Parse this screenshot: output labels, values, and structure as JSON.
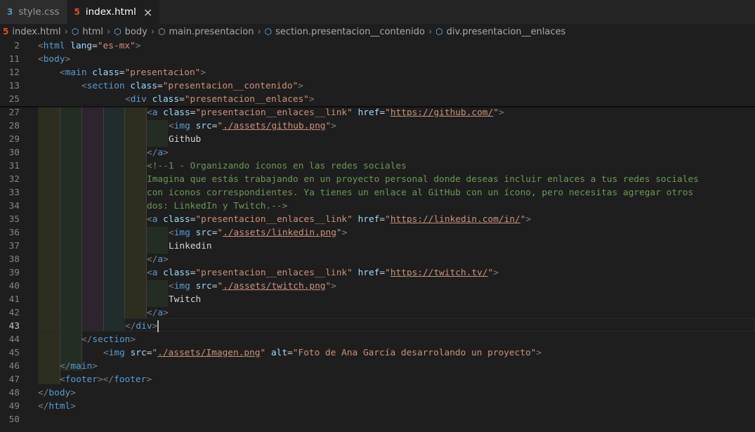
{
  "tabs": [
    {
      "icon": "css3-file-icon",
      "glyph": "3",
      "label": "style.css",
      "active": false
    },
    {
      "icon": "html5-file-icon",
      "glyph": "5",
      "label": "index.html",
      "active": true,
      "close": "×"
    }
  ],
  "breadcrumb": [
    {
      "icon": "html5-file-icon",
      "glyph": "5",
      "label": "index.html"
    },
    {
      "icon": "element-cube-icon",
      "glyph": "⬡",
      "label": "html"
    },
    {
      "icon": "element-cube-icon",
      "glyph": "⬡",
      "label": "body"
    },
    {
      "icon": "element-cube-icon",
      "glyph": "⬡",
      "label": "main.presentacion"
    },
    {
      "icon": "element-cube-icon",
      "glyph": "⬡",
      "label": "section.presentacion__contenido"
    },
    {
      "icon": "element-cube-icon",
      "glyph": "⬡",
      "label": "div.presentacion__enlaces"
    }
  ],
  "breadcrumb_separator": "›",
  "active_line": "43",
  "lines": [
    {
      "n": "2",
      "indent": 0,
      "tokens": [
        [
          "br",
          "<"
        ],
        [
          "tag",
          "html"
        ],
        [
          "txt",
          " "
        ],
        [
          "attr",
          "lang"
        ],
        [
          "txt",
          "="
        ],
        [
          "str",
          "\"es-mx\""
        ],
        [
          "br",
          ">"
        ]
      ]
    },
    {
      "n": "11",
      "indent": 0,
      "tokens": [
        [
          "br",
          "<"
        ],
        [
          "tag",
          "body"
        ],
        [
          "br",
          ">"
        ]
      ]
    },
    {
      "n": "12",
      "indent": 1,
      "tokens": [
        [
          "br",
          "<"
        ],
        [
          "tag",
          "main"
        ],
        [
          "txt",
          " "
        ],
        [
          "attr",
          "class"
        ],
        [
          "txt",
          "="
        ],
        [
          "str",
          "\"presentacion\""
        ],
        [
          "br",
          ">"
        ]
      ]
    },
    {
      "n": "13",
      "indent": 2,
      "tokens": [
        [
          "br",
          "<"
        ],
        [
          "tag",
          "section"
        ],
        [
          "txt",
          " "
        ],
        [
          "attr",
          "class"
        ],
        [
          "txt",
          "="
        ],
        [
          "str",
          "\"presentacion__contenido\""
        ],
        [
          "br",
          ">"
        ]
      ]
    },
    {
      "n": "25",
      "indent": 4,
      "tokens": [
        [
          "br",
          "<"
        ],
        [
          "tag",
          "div"
        ],
        [
          "txt",
          " "
        ],
        [
          "attr",
          "class"
        ],
        [
          "txt",
          "="
        ],
        [
          "str",
          "\"presentacion__enlaces\""
        ],
        [
          "br",
          ">"
        ]
      ]
    },
    {
      "n": "27",
      "indent": 5,
      "tokens": [
        [
          "br",
          "<"
        ],
        [
          "tag",
          "a"
        ],
        [
          "txt",
          " "
        ],
        [
          "attr",
          "class"
        ],
        [
          "txt",
          "="
        ],
        [
          "str",
          "\"presentacion__enlaces__link\""
        ],
        [
          "txt",
          " "
        ],
        [
          "attr",
          "href"
        ],
        [
          "txt",
          "="
        ],
        [
          "str",
          "\""
        ],
        [
          "url",
          "https://github.com/"
        ],
        [
          "str",
          "\""
        ],
        [
          "br",
          ">"
        ]
      ]
    },
    {
      "n": "28",
      "indent": 6,
      "tokens": [
        [
          "br",
          "<"
        ],
        [
          "tag",
          "img"
        ],
        [
          "txt",
          " "
        ],
        [
          "attr",
          "src"
        ],
        [
          "txt",
          "="
        ],
        [
          "str",
          "\""
        ],
        [
          "url",
          "./assets/github.png"
        ],
        [
          "str",
          "\""
        ],
        [
          "br",
          ">"
        ]
      ]
    },
    {
      "n": "29",
      "indent": 6,
      "tokens": [
        [
          "txt",
          "Github"
        ]
      ]
    },
    {
      "n": "30",
      "indent": 5,
      "tokens": [
        [
          "br",
          "</"
        ],
        [
          "tag",
          "a"
        ],
        [
          "br",
          ">"
        ]
      ]
    },
    {
      "n": "31",
      "indent": 5,
      "tokens": [
        [
          "com",
          "<!--1 - Organizando íconos en las redes sociales"
        ]
      ]
    },
    {
      "n": "32",
      "indent": 5,
      "tokens": [
        [
          "com",
          "Imagina que estás trabajando en un proyecto personal donde deseas incluir enlaces a tus redes sociales"
        ]
      ]
    },
    {
      "n": "33",
      "indent": 5,
      "tokens": [
        [
          "com",
          "con iconos correspondientes. Ya tienes un enlace al GitHub con un ícono, pero necesitas agregar otros"
        ]
      ]
    },
    {
      "n": "34",
      "indent": 5,
      "tokens": [
        [
          "com",
          "dos: LinkedIn y Twitch.-->"
        ]
      ]
    },
    {
      "n": "35",
      "indent": 5,
      "tokens": [
        [
          "br",
          "<"
        ],
        [
          "tag",
          "a"
        ],
        [
          "txt",
          " "
        ],
        [
          "attr",
          "class"
        ],
        [
          "txt",
          "="
        ],
        [
          "str",
          "\"presentacion__enlaces__link\""
        ],
        [
          "txt",
          " "
        ],
        [
          "attr",
          "href"
        ],
        [
          "txt",
          "="
        ],
        [
          "str",
          "\""
        ],
        [
          "url",
          "https://linkedin.com/in/"
        ],
        [
          "str",
          "\""
        ],
        [
          "br",
          ">"
        ]
      ]
    },
    {
      "n": "36",
      "indent": 6,
      "tokens": [
        [
          "br",
          "<"
        ],
        [
          "tag",
          "img"
        ],
        [
          "txt",
          " "
        ],
        [
          "attr",
          "src"
        ],
        [
          "txt",
          "="
        ],
        [
          "str",
          "\""
        ],
        [
          "url",
          "./assets/linkedin.png"
        ],
        [
          "str",
          "\""
        ],
        [
          "br",
          ">"
        ]
      ]
    },
    {
      "n": "37",
      "indent": 6,
      "tokens": [
        [
          "txt",
          "Linkedin"
        ]
      ]
    },
    {
      "n": "38",
      "indent": 5,
      "tokens": [
        [
          "br",
          "</"
        ],
        [
          "tag",
          "a"
        ],
        [
          "br",
          ">"
        ]
      ]
    },
    {
      "n": "39",
      "indent": 5,
      "tokens": [
        [
          "br",
          "<"
        ],
        [
          "tag",
          "a"
        ],
        [
          "txt",
          " "
        ],
        [
          "attr",
          "class"
        ],
        [
          "txt",
          "="
        ],
        [
          "str",
          "\"presentacion__enlaces__link\""
        ],
        [
          "txt",
          " "
        ],
        [
          "attr",
          "href"
        ],
        [
          "txt",
          "="
        ],
        [
          "str",
          "\""
        ],
        [
          "url",
          "https://twitch.tv/"
        ],
        [
          "str",
          "\""
        ],
        [
          "br",
          ">"
        ]
      ]
    },
    {
      "n": "40",
      "indent": 6,
      "tokens": [
        [
          "br",
          "<"
        ],
        [
          "tag",
          "img"
        ],
        [
          "txt",
          " "
        ],
        [
          "attr",
          "src"
        ],
        [
          "txt",
          "="
        ],
        [
          "str",
          "\""
        ],
        [
          "url",
          "./assets/twitch.png"
        ],
        [
          "str",
          "\""
        ],
        [
          "br",
          ">"
        ]
      ]
    },
    {
      "n": "41",
      "indent": 6,
      "tokens": [
        [
          "txt",
          "Twitch"
        ]
      ]
    },
    {
      "n": "42",
      "indent": 5,
      "tokens": [
        [
          "br",
          "</"
        ],
        [
          "tag",
          "a"
        ],
        [
          "br",
          ">"
        ]
      ]
    },
    {
      "n": "43",
      "indent": 4,
      "tokens": [
        [
          "br",
          "</"
        ],
        [
          "tag",
          "div"
        ],
        [
          "br",
          ">"
        ]
      ]
    },
    {
      "n": "44",
      "indent": 2,
      "tokens": [
        [
          "br",
          "</"
        ],
        [
          "tag",
          "section"
        ],
        [
          "br",
          ">"
        ]
      ]
    },
    {
      "n": "45",
      "indent": 3,
      "tokens": [
        [
          "br",
          "<"
        ],
        [
          "tag",
          "img"
        ],
        [
          "txt",
          " "
        ],
        [
          "attr",
          "src"
        ],
        [
          "txt",
          "="
        ],
        [
          "str",
          "\""
        ],
        [
          "url",
          "./assets/Imagen.png"
        ],
        [
          "str",
          "\""
        ],
        [
          "txt",
          " "
        ],
        [
          "attr",
          "alt"
        ],
        [
          "txt",
          "="
        ],
        [
          "str",
          "\"Foto de Ana García desarrolando un proyecto\""
        ],
        [
          "br",
          ">"
        ]
      ]
    },
    {
      "n": "46",
      "indent": 1,
      "tokens": [
        [
          "br",
          "</"
        ],
        [
          "tag",
          "main"
        ],
        [
          "br",
          ">"
        ]
      ]
    },
    {
      "n": "47",
      "indent": 1,
      "tokens": [
        [
          "br",
          "<"
        ],
        [
          "tag",
          "footer"
        ],
        [
          "br",
          "></"
        ],
        [
          "tag",
          "footer"
        ],
        [
          "br",
          ">"
        ]
      ]
    },
    {
      "n": "48",
      "indent": 0,
      "tokens": [
        [
          "br",
          "</"
        ],
        [
          "tag",
          "body"
        ],
        [
          "br",
          ">"
        ]
      ]
    },
    {
      "n": "49",
      "indent": 0,
      "tokens": [
        [
          "br",
          "</"
        ],
        [
          "tag",
          "html"
        ],
        [
          "br",
          ">"
        ]
      ]
    },
    {
      "n": "50",
      "indent": 0,
      "tokens": []
    }
  ]
}
